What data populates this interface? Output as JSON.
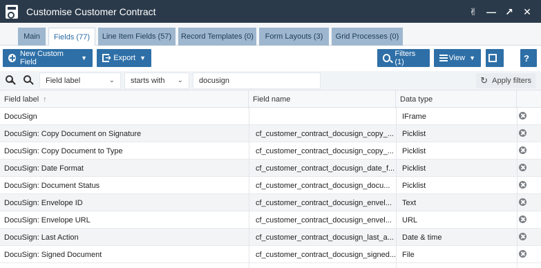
{
  "window": {
    "title": "Customise Customer Contract"
  },
  "tabs": [
    {
      "label": "Main"
    },
    {
      "label": "Fields (77)"
    },
    {
      "label": "Line Item Fields (57)"
    },
    {
      "label": "Record Templates (0)"
    },
    {
      "label": "Form Layouts (3)"
    },
    {
      "label": "Grid Processes (0)"
    }
  ],
  "active_tab": "Fields (77)",
  "toolbar": {
    "new_custom_field": "New Custom Field",
    "export": "Export",
    "filters": "Filters (1)",
    "view": "View"
  },
  "filter": {
    "field": "Field label",
    "operator": "starts with",
    "value": "docusign",
    "apply_label": "Apply filters"
  },
  "table": {
    "columns": [
      "Field label",
      "Field name",
      "Data type"
    ],
    "rows": [
      {
        "label": "DocuSign",
        "name": "",
        "type": "IFrame"
      },
      {
        "label": "DocuSign: Copy Document on Signature",
        "name": "cf_customer_contract_docusign_copy_...",
        "type": "Picklist"
      },
      {
        "label": "DocuSign: Copy Document to Type",
        "name": "cf_customer_contract_docusign_copy_...",
        "type": "Picklist"
      },
      {
        "label": "DocuSign: Date Format",
        "name": "cf_customer_contract_docusign_date_f...",
        "type": "Picklist"
      },
      {
        "label": "DocuSign: Document Status",
        "name": "cf_customer_contract_docusign_docu...",
        "type": "Picklist"
      },
      {
        "label": "DocuSign: Envelope ID",
        "name": "cf_customer_contract_docusign_envel...",
        "type": "Text"
      },
      {
        "label": "DocuSign: Envelope URL",
        "name": "cf_customer_contract_docusign_envel...",
        "type": "URL"
      },
      {
        "label": "DocuSign: Last Action",
        "name": "cf_customer_contract_docusign_last_a...",
        "type": "Date & time"
      },
      {
        "label": "DocuSign: Signed Document",
        "name": "cf_customer_contract_docusign_signed...",
        "type": "File"
      }
    ]
  }
}
